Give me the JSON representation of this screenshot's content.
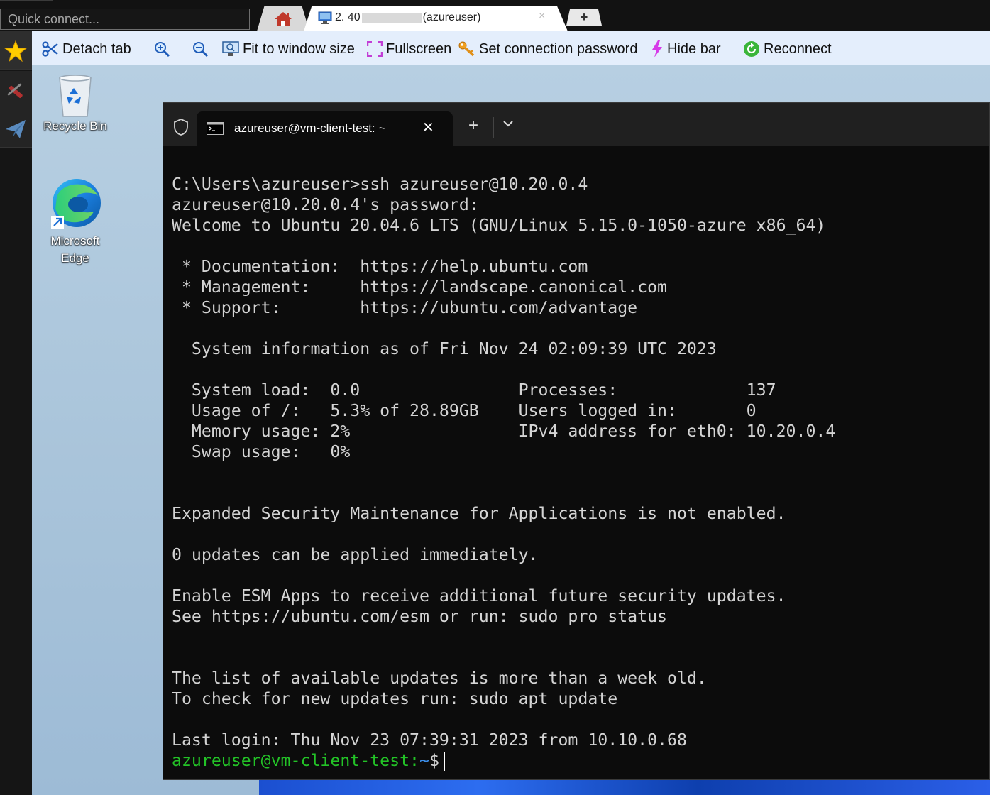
{
  "topbar": {
    "quick_connect_placeholder": "Quick connect...",
    "active_tab": {
      "prefix": "2. 40",
      "suffix": "(azureuser)",
      "close": "×"
    },
    "new_tab": "+"
  },
  "toolbar": {
    "detach_tab": "Detach tab",
    "fit_to_window": "Fit to window size",
    "fullscreen": "Fullscreen",
    "set_password": "Set connection password",
    "hide_bar": "Hide bar",
    "reconnect": "Reconnect"
  },
  "desktop": {
    "recycle_bin": "Recycle Bin",
    "edge_line1": "Microsoft",
    "edge_line2": "Edge"
  },
  "terminal": {
    "tab_title": "azureuser@vm-client-test: ~",
    "tab_close": "✕",
    "new_tab": "+",
    "lines": [
      "C:\\Users\\azureuser>ssh azureuser@10.20.0.4",
      "azureuser@10.20.0.4's password:",
      "Welcome to Ubuntu 20.04.6 LTS (GNU/Linux 5.15.0-1050-azure x86_64)",
      "",
      " * Documentation:  https://help.ubuntu.com",
      " * Management:     https://landscape.canonical.com",
      " * Support:        https://ubuntu.com/advantage",
      "",
      "  System information as of Fri Nov 24 02:09:39 UTC 2023",
      "",
      "  System load:  0.0                Processes:             137",
      "  Usage of /:   5.3% of 28.89GB    Users logged in:       0",
      "  Memory usage: 2%                 IPv4 address for eth0: 10.20.0.4",
      "  Swap usage:   0%",
      "",
      "",
      "Expanded Security Maintenance for Applications is not enabled.",
      "",
      "0 updates can be applied immediately.",
      "",
      "Enable ESM Apps to receive additional future security updates.",
      "See https://ubuntu.com/esm or run: sudo pro status",
      "",
      "",
      "The list of available updates is more than a week old.",
      "To check for new updates run: sudo apt update",
      "",
      "Last login: Thu Nov 23 07:39:31 2023 from 10.10.0.68"
    ],
    "prompt_user": "azureuser@vm-client-test",
    "prompt_sep": ":",
    "prompt_path": "~",
    "prompt_symbol": "$"
  },
  "colors": {
    "prompt_user": "#23c327",
    "prompt_path": "#3b8eea",
    "terminal_bg": "#0c0c0c",
    "toolbar_bg": "#e4eefc"
  }
}
